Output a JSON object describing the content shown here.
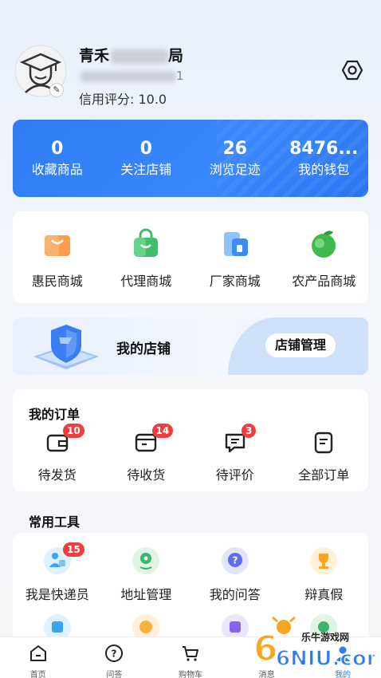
{
  "profile": {
    "username_visible": "青禾",
    "username_tail": "局",
    "phone_tail": "1",
    "credit_label": "信用评分: 10.0"
  },
  "stats": [
    {
      "value": "0",
      "label": "收藏商品"
    },
    {
      "value": "0",
      "label": "关注店铺"
    },
    {
      "value": "26",
      "label": "浏览足迹"
    },
    {
      "value": "8476...",
      "label": "我的钱包"
    }
  ],
  "malls": [
    {
      "label": "惠民商城",
      "icon": "shopping-bag-icon"
    },
    {
      "label": "代理商城",
      "icon": "lock-bag-icon"
    },
    {
      "label": "厂家商城",
      "icon": "factory-icon"
    },
    {
      "label": "农产品商城",
      "icon": "fruit-icon"
    }
  ],
  "store": {
    "title": "我的店铺",
    "manage_label": "店铺管理"
  },
  "orders": {
    "title": "我的订单",
    "items": [
      {
        "label": "待发货",
        "badge": "10",
        "icon": "wallet-icon"
      },
      {
        "label": "待收货",
        "badge": "14",
        "icon": "package-icon"
      },
      {
        "label": "待评价",
        "badge": "3",
        "icon": "comment-icon"
      },
      {
        "label": "全部订单",
        "badge": "",
        "icon": "document-icon"
      }
    ]
  },
  "tools": {
    "title": "常用工具",
    "items": [
      {
        "label": "我是快递员",
        "badge": "15",
        "icon": "courier-icon"
      },
      {
        "label": "地址管理",
        "badge": "",
        "icon": "location-icon"
      },
      {
        "label": "我的问答",
        "badge": "",
        "icon": "question-icon"
      },
      {
        "label": "辩真假",
        "badge": "",
        "icon": "trophy-icon"
      }
    ]
  },
  "tabbar": [
    {
      "label": "首页",
      "icon": "home-icon",
      "active": false
    },
    {
      "label": "问答",
      "icon": "question-circle-icon",
      "active": false
    },
    {
      "label": "购物车",
      "icon": "cart-icon",
      "active": false
    },
    {
      "label": "消息",
      "icon": "message-icon",
      "active": false
    },
    {
      "label": "我的",
      "icon": "profile-icon",
      "active": true
    }
  ],
  "watermark": {
    "logo_text": "6NIU.com",
    "text": "乐牛游戏网"
  },
  "colors": {
    "accent": "#2f7bf3",
    "badge": "#f33c3c"
  }
}
